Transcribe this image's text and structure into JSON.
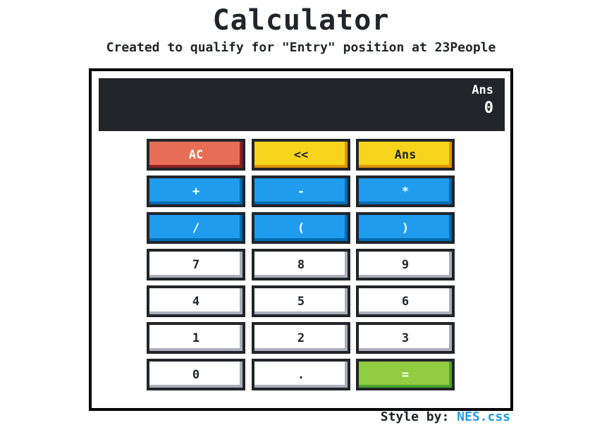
{
  "header": {
    "title": "Calculator",
    "subtitle": "Created to qualify for \"Entry\" position at 23People"
  },
  "display": {
    "label": "Ans",
    "value": "0"
  },
  "keys": {
    "ac": "AC",
    "backspace": "<<",
    "ans": "Ans",
    "plus": "+",
    "minus": "-",
    "multiply": "*",
    "divide": "/",
    "open_paren": "(",
    "close_paren": ")",
    "seven": "7",
    "eight": "8",
    "nine": "9",
    "four": "4",
    "five": "5",
    "six": "6",
    "one": "1",
    "two": "2",
    "three": "3",
    "zero": "0",
    "dot": ".",
    "equals": "="
  },
  "footer": {
    "prefix": "Style by:",
    "link": "NES.css"
  },
  "colors": {
    "primary": "#209cee",
    "warning": "#f7d51d",
    "error": "#e76e55",
    "success": "#92cc41",
    "dark": "#212529"
  }
}
